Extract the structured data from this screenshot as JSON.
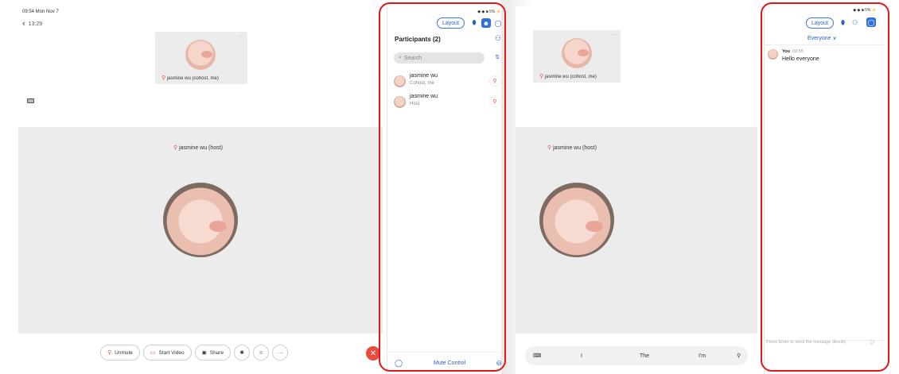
{
  "left": {
    "status_time": "09:54 Mon Nov 7",
    "back_label": "13:29",
    "self_tile_label": "jasmine wu (cohost, me)",
    "host_label": "jasmine wu (host)",
    "toolbar": {
      "unmute": "Unmute",
      "start_video": "Start Video",
      "share": "Share",
      "more": "···"
    },
    "end_icon": "close-icon",
    "participants_panel": {
      "status": "◆ ◆ ■ 5% ⚡",
      "layout_button": "Layout",
      "title": "Participants (2)",
      "search_placeholder": "Search",
      "participants": [
        {
          "name": "jasmine wu",
          "role": "Cohost, me"
        },
        {
          "name": "jasmine wu",
          "role": "Host"
        }
      ],
      "mute_control": "Mute Control"
    }
  },
  "right": {
    "self_tile_label": "jasmine wu (cohost, me)",
    "host_label": "jasmine wu (host)",
    "keyboard_suggestions": [
      "I",
      "The",
      "I'm"
    ],
    "chat_panel": {
      "status": "◆ ◆ ■ 5% ⚡",
      "layout_button": "Layout",
      "audience": "Everyone ∨",
      "message": {
        "sender": "You",
        "time": "09:55",
        "text": "Hello everyone"
      },
      "input_placeholder": "Press Enter to send the message directly"
    }
  },
  "colors": {
    "accent": "#2f6fe0",
    "annotation": "#e01818",
    "end_red": "#e74c3c"
  }
}
